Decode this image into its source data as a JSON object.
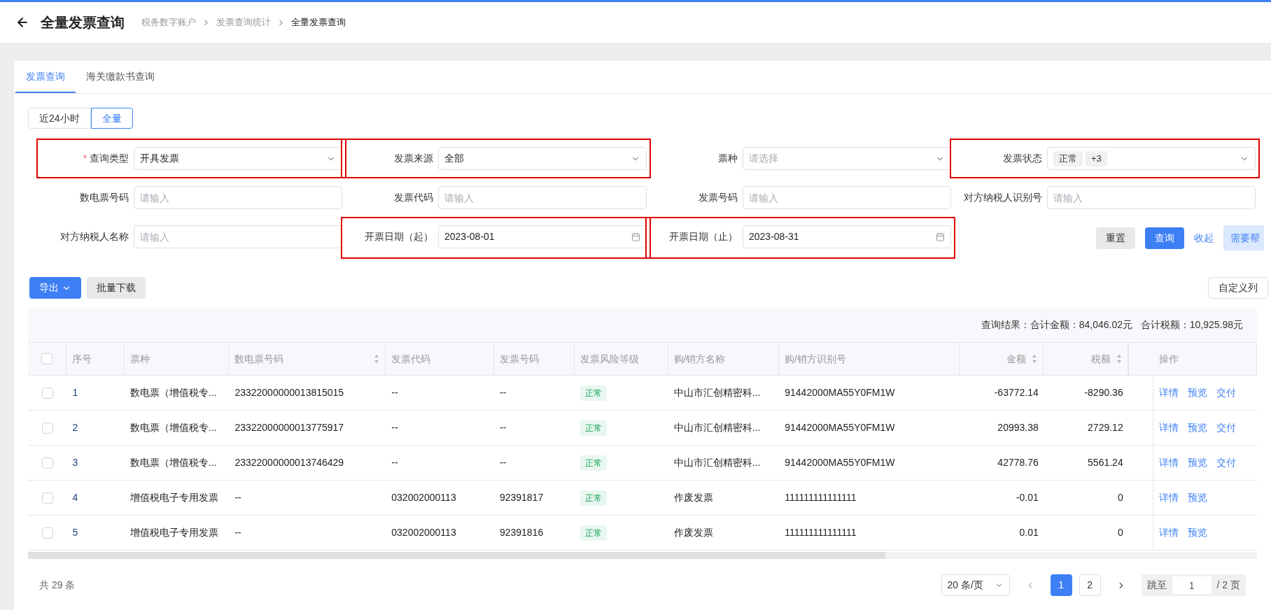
{
  "header": {
    "title": "全量发票查询",
    "breadcrumb": [
      "税务数字账户",
      "发票查询统计",
      "全量发票查询"
    ]
  },
  "tabs": [
    {
      "label": "发票查询",
      "selected": true
    },
    {
      "label": "海关缴款书查询",
      "selected": false
    }
  ],
  "range_toggle": [
    {
      "label": "近24小时",
      "selected": false
    },
    {
      "label": "全量",
      "selected": true
    }
  ],
  "form_fields": [
    {
      "label": "查询类型",
      "required_mark": "*",
      "kind": "select",
      "value": "开具发票",
      "highlighted": true
    },
    {
      "label": "发票来源",
      "kind": "select",
      "value": "全部",
      "highlighted": true
    },
    {
      "label": "票种",
      "kind": "select",
      "placeholder": "请选择",
      "highlighted": false
    },
    {
      "label": "发票状态",
      "kind": "tags",
      "tags": [
        "正常",
        "+3"
      ],
      "highlighted": true
    },
    {
      "label": "数电票号码",
      "kind": "input",
      "placeholder": "请输入",
      "highlighted": false
    },
    {
      "label": "发票代码",
      "kind": "input",
      "placeholder": "请输入",
      "highlighted": false
    },
    {
      "label": "发票号码",
      "kind": "input",
      "placeholder": "请输入",
      "highlighted": false
    },
    {
      "label": "对方纳税人识别号",
      "kind": "input",
      "placeholder": "请输入",
      "highlighted": false
    },
    {
      "label": "对方纳税人名称",
      "kind": "input",
      "placeholder": "请输入",
      "highlighted": false
    },
    {
      "label": "开票日期（起）",
      "kind": "date",
      "value": "2023-08-01",
      "highlighted": true
    },
    {
      "label": "开票日期（止）",
      "kind": "date",
      "value": "2023-08-31",
      "highlighted": true
    }
  ],
  "form_actions": {
    "reset": "重置",
    "query": "查询",
    "collapse": "收起",
    "help": "需要帮"
  },
  "toolbar": {
    "export": "导出",
    "batch_download": "批量下载",
    "custom_columns": "自定义列"
  },
  "summary": "查询结果：合计金额：84,046.02元   合计税额：10,925.98元",
  "table": {
    "select_all": {
      "checked": false
    },
    "columns": [
      {
        "label": "序号",
        "sortable": false,
        "kind": "text"
      },
      {
        "label": "票种",
        "sortable": false,
        "kind": "text"
      },
      {
        "label": "数电票号码",
        "sortable": true,
        "kind": "text"
      },
      {
        "label": "发票代码",
        "sortable": false,
        "kind": "text"
      },
      {
        "label": "发票号码",
        "sortable": false,
        "kind": "text"
      },
      {
        "label": "发票风险等级",
        "sortable": false,
        "kind": "badge"
      },
      {
        "label": "购/销方名称",
        "sortable": false,
        "kind": "text"
      },
      {
        "label": "购/销方识别号",
        "sortable": false,
        "kind": "text"
      },
      {
        "label": "金额",
        "sortable": true,
        "kind": "amount"
      },
      {
        "label": "税额",
        "sortable": true,
        "kind": "amount"
      },
      {
        "label": "操作",
        "sortable": false,
        "kind": "actions"
      }
    ],
    "rows": [
      {
        "checked": false,
        "cells": [
          "1",
          "数电票（增值税专...",
          "23322000000013815015",
          "--",
          "--",
          "正常",
          "中山市汇创精密科...",
          "91442000MA55Y0FM1W",
          "-63772.14",
          "-8290.36"
        ],
        "actions": [
          "详情",
          "预览",
          "交付"
        ]
      },
      {
        "checked": false,
        "cells": [
          "2",
          "数电票（增值税专...",
          "23322000000013775917",
          "--",
          "--",
          "正常",
          "中山市汇创精密科...",
          "91442000MA55Y0FM1W",
          "20993.38",
          "2729.12"
        ],
        "actions": [
          "详情",
          "预览",
          "交付"
        ]
      },
      {
        "checked": false,
        "cells": [
          "3",
          "数电票（增值税专...",
          "23322000000013746429",
          "--",
          "--",
          "正常",
          "中山市汇创精密科...",
          "91442000MA55Y0FM1W",
          "42778.76",
          "5561.24"
        ],
        "actions": [
          "详情",
          "预览",
          "交付"
        ]
      },
      {
        "checked": false,
        "cells": [
          "4",
          "增值税电子专用发票",
          "--",
          "032002000113",
          "92391817",
          "正常",
          "作废发票",
          "111111111111111",
          "-0.01",
          "0"
        ],
        "actions": [
          "详情",
          "预览"
        ]
      },
      {
        "checked": false,
        "cells": [
          "5",
          "增值税电子专用发票",
          "--",
          "032002000113",
          "92391816",
          "正常",
          "作废发票",
          "111111111111111",
          "0.01",
          "0"
        ],
        "actions": [
          "详情",
          "预览"
        ]
      }
    ]
  },
  "pagination": {
    "total": "共 29 条",
    "page_size": "20 条/页",
    "pages": [
      {
        "label": "1",
        "selected": true
      },
      {
        "label": "2",
        "selected": false
      }
    ],
    "jump_label": "跳至",
    "jump_value": "1",
    "page_count": "/ 2 页"
  }
}
